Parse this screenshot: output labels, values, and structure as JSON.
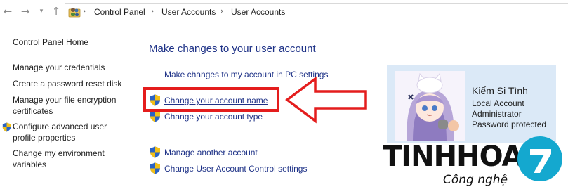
{
  "addressbar": {
    "breadcrumbs": [
      "Control Panel",
      "User Accounts",
      "User Accounts"
    ]
  },
  "sidebar": {
    "home": "Control Panel Home",
    "links": [
      "Manage your credentials",
      "Create a password reset disk",
      "Manage your file encryption certificates",
      "Configure advanced user profile properties",
      "Change my environment variables"
    ]
  },
  "main": {
    "title": "Make changes to your user account",
    "tasks": [
      "Make changes to my account in PC settings",
      "Change your account name",
      "Change your account type"
    ],
    "more_tasks": [
      "Manage another account",
      "Change User Account Control settings"
    ]
  },
  "account": {
    "name": "Kiếm Si Tình",
    "type": "Local Account",
    "role": "Administrator",
    "status": "Password protected"
  },
  "watermark": {
    "word": "TINHHOA",
    "sub": "Công nghệ",
    "digit": "7"
  },
  "colors": {
    "link": "#1e3287",
    "highlight": "#e41d1d",
    "card": "#dbe9f7",
    "logo_teal": "#14a8cf"
  },
  "icons": [
    "back-arrow-icon",
    "forward-arrow-icon",
    "dropdown-icon",
    "up-arrow-icon",
    "users-folder-icon",
    "uac-shield-icon"
  ]
}
